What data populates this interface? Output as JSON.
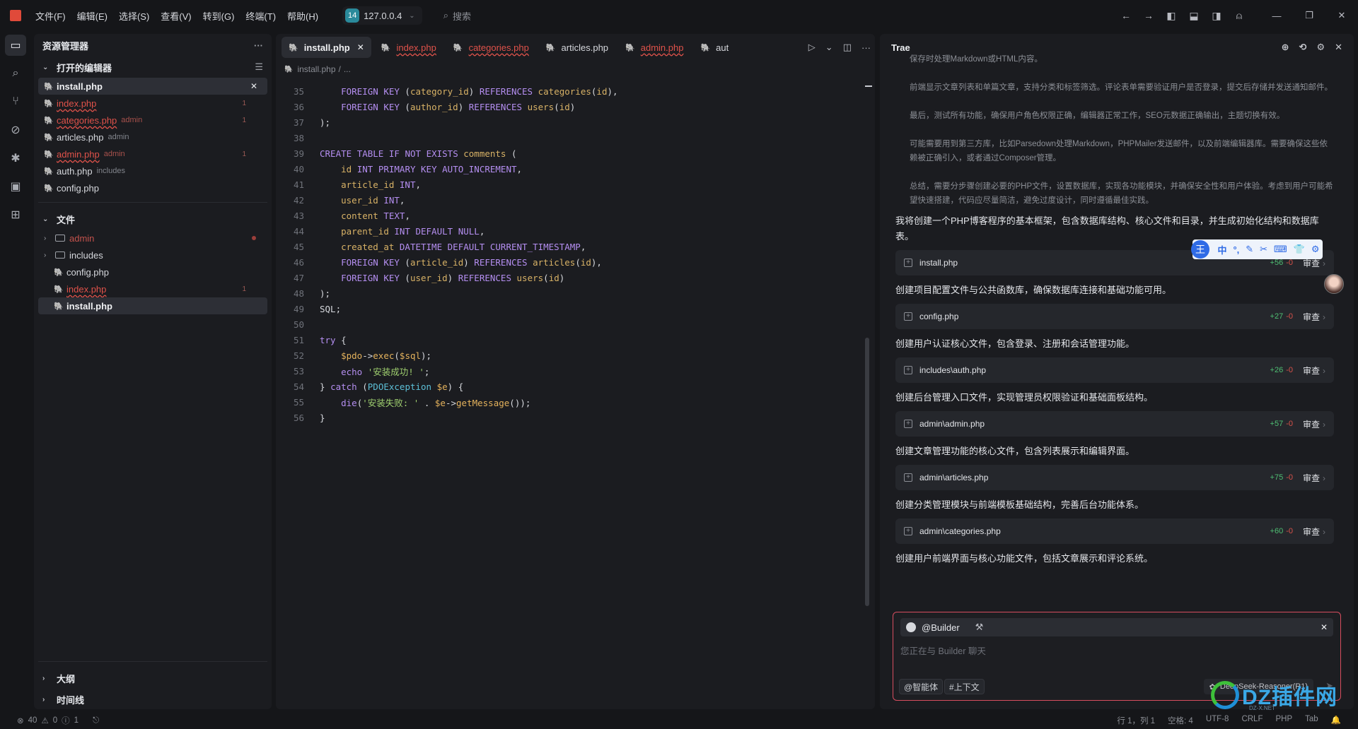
{
  "menu": [
    "文件(F)",
    "编辑(E)",
    "选择(S)",
    "查看(V)",
    "转到(G)",
    "终端(T)",
    "帮助(H)"
  ],
  "host": {
    "badge": "14",
    "name": "127.0.0.4"
  },
  "search": {
    "label": "搜索"
  },
  "explorer": {
    "title": "资源管理器",
    "open_editors": {
      "title": "打开的编辑器",
      "items": [
        {
          "name": "install.php",
          "desc": "",
          "badge": ""
        },
        {
          "name": "index.php",
          "desc": "",
          "badge": "1"
        },
        {
          "name": "categories.php",
          "desc": "admin",
          "badge": "1"
        },
        {
          "name": "articles.php",
          "desc": "admin",
          "badge": ""
        },
        {
          "name": "admin.php",
          "desc": "admin",
          "badge": "1"
        },
        {
          "name": "auth.php",
          "desc": "includes",
          "badge": ""
        },
        {
          "name": "config.php",
          "desc": "",
          "badge": ""
        }
      ]
    },
    "files": {
      "title": "文件",
      "items": [
        {
          "name": "admin"
        },
        {
          "name": "includes"
        },
        {
          "name": "config.php"
        },
        {
          "name": "index.php",
          "badge": "1"
        },
        {
          "name": "install.php"
        }
      ]
    },
    "outline": "大纲",
    "timeline": "时间线"
  },
  "editor": {
    "tabs": [
      {
        "name": "install.php"
      },
      {
        "name": "index.php"
      },
      {
        "name": "categories.php"
      },
      {
        "name": "articles.php"
      },
      {
        "name": "admin.php"
      },
      {
        "name": "aut"
      }
    ],
    "breadcrumb": [
      "install.php",
      "..."
    ],
    "lines": [
      {
        "n": "35",
        "text": "    FOREIGN KEY (category_id) REFERENCES categories(id),"
      },
      {
        "n": "36",
        "text": "    FOREIGN KEY (author_id) REFERENCES users(id)"
      },
      {
        "n": "37",
        "text": ");"
      },
      {
        "n": "38",
        "text": ""
      },
      {
        "n": "39",
        "text": "CREATE TABLE IF NOT EXISTS comments ("
      },
      {
        "n": "40",
        "text": "    id INT PRIMARY KEY AUTO_INCREMENT,"
      },
      {
        "n": "41",
        "text": "    article_id INT,"
      },
      {
        "n": "42",
        "text": "    user_id INT,"
      },
      {
        "n": "43",
        "text": "    content TEXT,"
      },
      {
        "n": "44",
        "text": "    parent_id INT DEFAULT NULL,"
      },
      {
        "n": "45",
        "text": "    created_at DATETIME DEFAULT CURRENT_TIMESTAMP,"
      },
      {
        "n": "46",
        "text": "    FOREIGN KEY (article_id) REFERENCES articles(id),"
      },
      {
        "n": "47",
        "text": "    FOREIGN KEY (user_id) REFERENCES users(id)"
      },
      {
        "n": "48",
        "text": ");"
      },
      {
        "n": "49",
        "text": "SQL;"
      },
      {
        "n": "50",
        "text": ""
      },
      {
        "n": "51",
        "text": "try {"
      },
      {
        "n": "52",
        "text": "    $pdo->exec($sql);"
      },
      {
        "n": "53",
        "text": "    echo '安装成功! ';"
      },
      {
        "n": "54",
        "text": "} catch (PDOException $e) {"
      },
      {
        "n": "55",
        "text": "    die('安装失败: ' . $e->getMessage());"
      },
      {
        "n": "56",
        "text": "}"
      }
    ]
  },
  "chat": {
    "title": "Trae",
    "thoughts": [
      "保存时处理Markdown或HTML内容。",
      "前端显示文章列表和单篇文章，支持分类和标签筛选。评论表单需要验证用户是否登录，提交后存储并发送通知邮件。",
      "最后，测试所有功能，确保用户角色权限正确，编辑器正常工作，SEO元数据正确输出，主题切换有效。",
      "可能需要用到第三方库，比如Parsedown处理Markdown，PHPMailer发送邮件，以及前端编辑器库。需要确保这些依赖被正确引入，或者通过Composer管理。",
      "总结，需要分步骤创建必要的PHP文件，设置数据库，实现各功能模块，并确保安全性和用户体验。考虑到用户可能希望快速搭建，代码应尽量简洁，避免过度设计，同时遵循最佳实践。"
    ],
    "intro": "我将创建一个PHP博客程序的基本框架，包含数据库结构、核心文件和目录，并生成初始化结构和数据库表。",
    "steps": [
      {
        "file": "install.php",
        "add": "+56",
        "del": "-0",
        "review": "审查",
        "after": "创建项目配置文件与公共函数库，确保数据库连接和基础功能可用。"
      },
      {
        "file": "config.php",
        "add": "+27",
        "del": "-0",
        "review": "审查",
        "after": "创建用户认证核心文件，包含登录、注册和会话管理功能。"
      },
      {
        "file": "includes\\auth.php",
        "add": "+26",
        "del": "-0",
        "review": "审查",
        "after": "创建后台管理入口文件，实现管理员权限验证和基础面板结构。"
      },
      {
        "file": "admin\\admin.php",
        "add": "+57",
        "del": "-0",
        "review": "审查",
        "after": "创建文章管理功能的核心文件，包含列表展示和编辑界面。"
      },
      {
        "file": "admin\\articles.php",
        "add": "+75",
        "del": "-0",
        "review": "审查",
        "after": "创建分类管理模块与前端模板基础结构，完善后台功能体系。"
      },
      {
        "file": "admin\\categories.php",
        "add": "+60",
        "del": "-0",
        "review": "审查",
        "after": "创建用户前端界面与核心功能文件，包括文章展示和评论系统。"
      }
    ],
    "ime": [
      "中",
      "°,",
      "✎",
      "✂",
      "⌨",
      "👕",
      "⚙"
    ],
    "input": {
      "agent": "@Builder",
      "placeholder": "您正在与 Builder 聊天",
      "chip_agent": "@智能体",
      "chip_context": "#上下文",
      "model": "DeepSeek-Reasoner(R1)"
    }
  },
  "status": {
    "left": [
      "40",
      "0",
      "1"
    ],
    "right": [
      "行 1，列 1",
      "空格: 4",
      "UTF-8",
      "CRLF",
      "PHP",
      "Tab"
    ]
  },
  "watermark": {
    "text": "DZ插件网",
    "sub": "DZ-X.NET"
  },
  "colors": {
    "accent": "#8e7cf2",
    "error": "#e0524a",
    "add": "#4fbf73",
    "input_border": "#d74d5f"
  }
}
